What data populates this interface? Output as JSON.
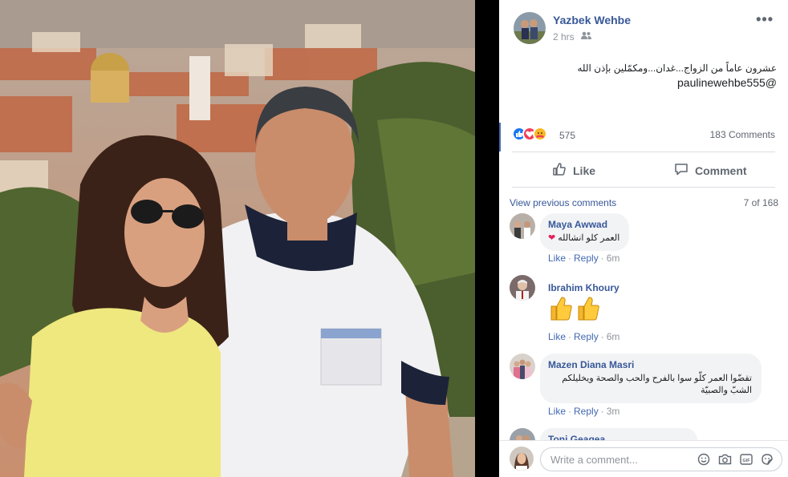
{
  "post": {
    "author": "Yazbek Wehbe",
    "time": "2 hrs",
    "text_line1": "عشرون عاماً من الزواج...غدان...ومكمّلين بإذن الله",
    "text_line2": "paulinewehbe555@",
    "reactions_count": "575",
    "comments_count": "183 Comments"
  },
  "actions": {
    "like": "Like",
    "comment": "Comment"
  },
  "comments_header": {
    "view_previous": "View previous comments",
    "page": "7 of 168"
  },
  "comments": [
    {
      "name": "Maya Awwad",
      "text": "العمر كلو انشالله",
      "like": "Like",
      "reply": "Reply",
      "time": "6m"
    },
    {
      "name": "Ibrahim Khoury",
      "text": "",
      "like": "Like",
      "reply": "Reply",
      "time": "6m"
    },
    {
      "name": "Mazen Diana Masri",
      "text": "تقضّوا العمر كلّو سوا بالفرح والحب والصحة ويخليلكم الشبّ والصبيّة",
      "like": "Like",
      "reply": "Reply",
      "time": "3m"
    },
    {
      "name": "Toni Geagea"
    }
  ],
  "write_bar": {
    "placeholder": "Write a comment..."
  },
  "colors": {
    "link": "#385898",
    "accent": "#4267b2",
    "muted": "#90949c",
    "bubble": "#f2f3f5"
  }
}
